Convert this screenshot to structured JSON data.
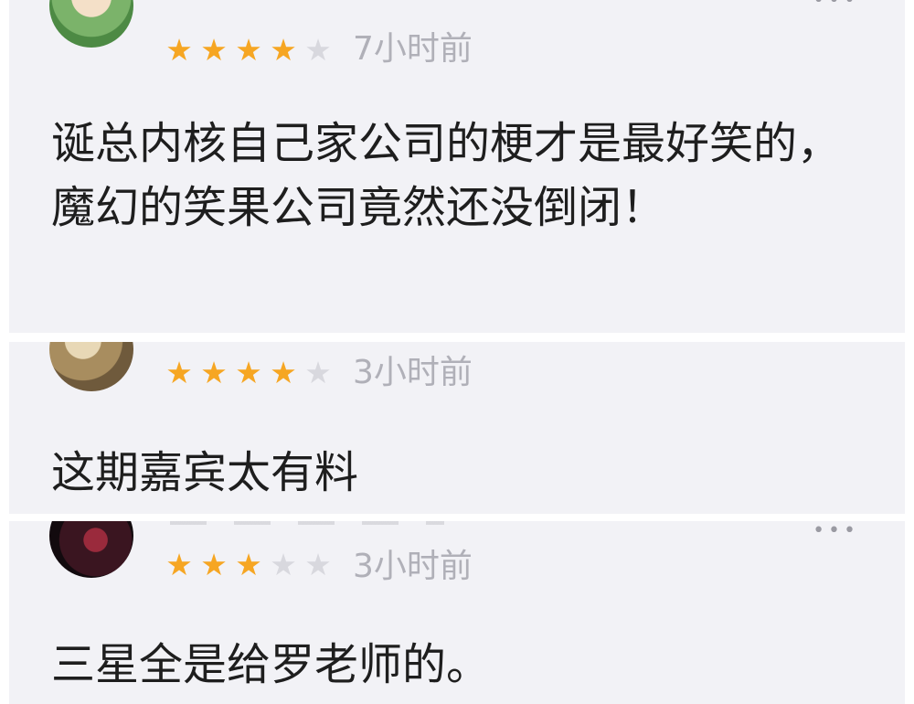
{
  "comments": [
    {
      "rating": 4,
      "time": "7小时前",
      "text": "诞总内核自己家公司的梗才是最好笑的，魔幻的笑果公司竟然还没倒闭！"
    },
    {
      "rating": 4,
      "time": "3小时前",
      "text": "这期嘉宾太有料"
    },
    {
      "rating": 3,
      "time": "3小时前",
      "text": "三星全是给罗老师的。"
    }
  ],
  "icons": {
    "star_filled": "★",
    "star_empty": "★",
    "more": "•••"
  },
  "colors": {
    "star_active": "#f6a623",
    "star_inactive": "#d8d8de",
    "card_bg": "#f2f2f6",
    "time_text": "#b0b0b8"
  }
}
